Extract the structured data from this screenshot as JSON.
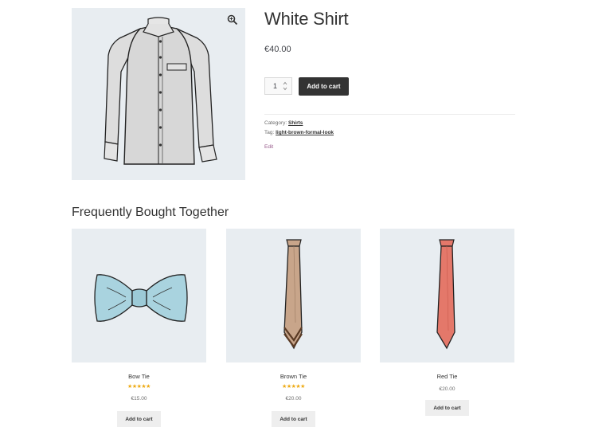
{
  "product": {
    "title": "White Shirt",
    "price": "€40.00",
    "quantity": "1",
    "add_to_cart_label": "Add to cart",
    "category_label": "Category:",
    "category_value": "Shirts",
    "tag_label": "Tag:",
    "tag_value": "light-brown-formal-look",
    "edit_label": "Edit"
  },
  "related": {
    "heading": "Frequently Bought Together",
    "items": [
      {
        "title": "Bow Tie",
        "rating": 5,
        "stars": "★★★★★",
        "price": "€15.00",
        "button": "Add to cart"
      },
      {
        "title": "Brown Tie",
        "rating": 5,
        "stars": "★★★★★",
        "price": "€20.00",
        "button": "Add to cart"
      },
      {
        "title": "Red Tie",
        "price": "€20.00",
        "button": "Add to cart"
      }
    ]
  },
  "colors": {
    "image_background": "#e8edf1",
    "primary_button": "#333333",
    "secondary_button": "#eeeeee",
    "star": "#eeaa12",
    "edit_link": "#96588a",
    "bow_tie": "#a9d3df",
    "brown_tie": "#c8a58a",
    "red_tie": "#e4786a"
  },
  "icons": {
    "zoom": "magnifier-zoom-icon",
    "quantity_arrows": "up-down-arrows-icon"
  }
}
